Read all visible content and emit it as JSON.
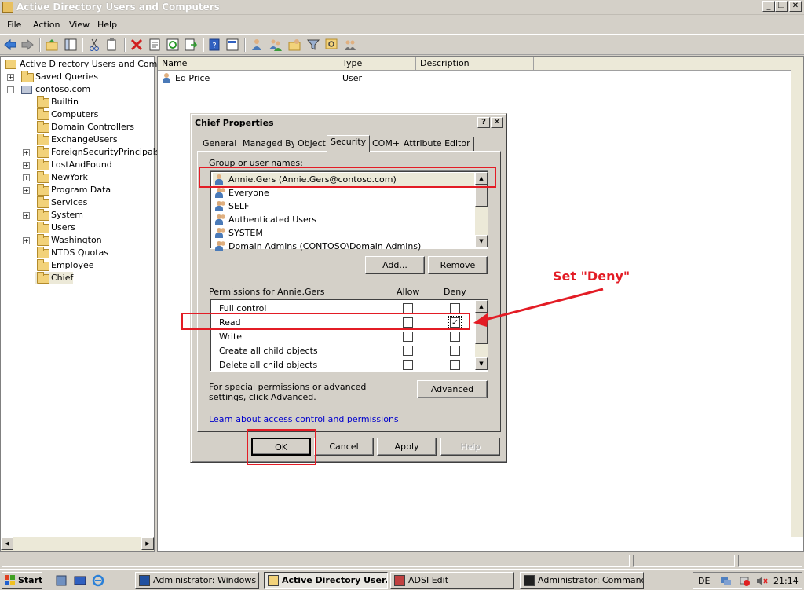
{
  "window": {
    "title": "Active Directory Users and Computers",
    "min": "_",
    "restore": "❐",
    "close": "✕"
  },
  "menu": [
    "File",
    "Action",
    "View",
    "Help"
  ],
  "tree": {
    "root": "Active Directory Users and Comput",
    "items": [
      {
        "label": "Saved Queries",
        "level": 1,
        "expander": "+"
      },
      {
        "label": "contoso.com",
        "level": 1,
        "expander": "−"
      },
      {
        "label": "Builtin",
        "level": 2,
        "expander": ""
      },
      {
        "label": "Computers",
        "level": 2,
        "expander": ""
      },
      {
        "label": "Domain Controllers",
        "level": 2,
        "expander": ""
      },
      {
        "label": "ExchangeUsers",
        "level": 2,
        "expander": ""
      },
      {
        "label": "ForeignSecurityPrincipals",
        "level": 2,
        "expander": "+"
      },
      {
        "label": "LostAndFound",
        "level": 2,
        "expander": "+"
      },
      {
        "label": "NewYork",
        "level": 2,
        "expander": "+"
      },
      {
        "label": "Program Data",
        "level": 2,
        "expander": "+"
      },
      {
        "label": "Services",
        "level": 2,
        "expander": ""
      },
      {
        "label": "System",
        "level": 2,
        "expander": "+"
      },
      {
        "label": "Users",
        "level": 2,
        "expander": ""
      },
      {
        "label": "Washington",
        "level": 2,
        "expander": "+"
      },
      {
        "label": "NTDS Quotas",
        "level": 2,
        "expander": ""
      },
      {
        "label": "Employee",
        "level": 2,
        "expander": ""
      },
      {
        "label": "Chief",
        "level": 2,
        "expander": ""
      }
    ]
  },
  "list": {
    "columns": [
      "Name",
      "Type",
      "Description"
    ],
    "rows": [
      {
        "name": "Ed Price",
        "type": "User",
        "description": ""
      }
    ]
  },
  "dialog": {
    "title": "Chief Properties",
    "help_btn": "?",
    "close_btn": "✕",
    "tabs": [
      "General",
      "Managed By",
      "Object",
      "Security",
      "COM+",
      "Attribute Editor"
    ],
    "selected_tab": "Security",
    "group_label": "Group or user names:",
    "users": [
      "Annie.Gers (Annie.Gers@contoso.com)",
      "Everyone",
      "SELF",
      "Authenticated Users",
      "SYSTEM",
      "Domain Admins (CONTOSO\\Domain Admins)"
    ],
    "add_btn": "Add...",
    "remove_btn": "Remove",
    "perm_label": "Permissions for Annie.Gers",
    "allow_hdr": "Allow",
    "deny_hdr": "Deny",
    "permissions": [
      {
        "name": "Full control",
        "allow": false,
        "deny": false
      },
      {
        "name": "Read",
        "allow": false,
        "deny": true
      },
      {
        "name": "Write",
        "allow": false,
        "deny": false
      },
      {
        "name": "Create all child objects",
        "allow": false,
        "deny": false
      },
      {
        "name": "Delete all child objects",
        "allow": false,
        "deny": false
      }
    ],
    "special_text": "For special permissions or advanced settings, click Advanced.",
    "advanced_btn": "Advanced",
    "learn_link": "Learn about access control and permissions",
    "ok_btn": "OK",
    "cancel_btn": "Cancel",
    "apply_btn": "Apply",
    "helpbtn": "Help"
  },
  "annotation": {
    "text": "Set \"Deny\"",
    "color": "#e31c25"
  },
  "taskbar": {
    "start": "Start",
    "tasks": [
      {
        "label": "Administrator: Windows ...",
        "active": false
      },
      {
        "label": "Active Directory User...",
        "active": true
      },
      {
        "label": "ADSI Edit",
        "active": false
      },
      {
        "label": "Administrator: Command...",
        "active": false
      }
    ],
    "lang": "DE",
    "time": "21:14"
  }
}
